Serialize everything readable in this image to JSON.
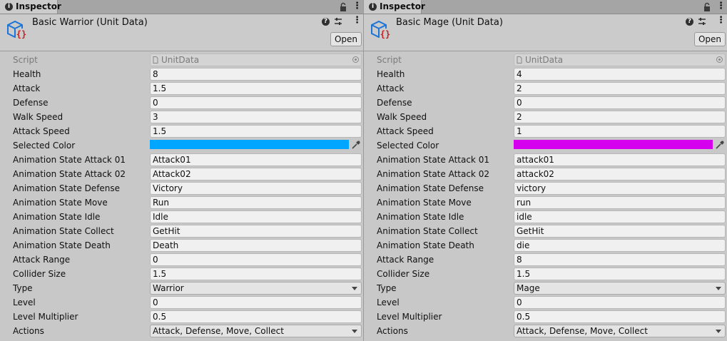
{
  "panels": [
    {
      "tab": {
        "label": "Inspector",
        "info_glyph": "i",
        "menu_glyph": "⋮"
      },
      "header": {
        "title": "Basic Warrior (Unit Data)",
        "help_glyph": "?",
        "menu_glyph": "⋮",
        "open_label": "Open"
      },
      "fields": {
        "script": {
          "label": "Script",
          "value": "UnitData"
        },
        "health": {
          "label": "Health",
          "value": "8"
        },
        "attack": {
          "label": "Attack",
          "value": "1.5"
        },
        "defense": {
          "label": "Defense",
          "value": "0"
        },
        "walk_speed": {
          "label": "Walk Speed",
          "value": "3"
        },
        "attack_speed": {
          "label": "Attack Speed",
          "value": "1.5"
        },
        "selected_color": {
          "label": "Selected Color",
          "value": "#00a6ff"
        },
        "anim_attack01": {
          "label": "Animation State Attack 01",
          "value": "Attack01"
        },
        "anim_attack02": {
          "label": "Animation State Attack 02",
          "value": "Attack02"
        },
        "anim_defense": {
          "label": "Animation State Defense",
          "value": "Victory"
        },
        "anim_move": {
          "label": "Animation State Move",
          "value": "Run"
        },
        "anim_idle": {
          "label": "Animation State Idle",
          "value": "Idle"
        },
        "anim_collect": {
          "label": "Animation State Collect",
          "value": "GetHit"
        },
        "anim_death": {
          "label": "Animation State Death",
          "value": "Death"
        },
        "attack_range": {
          "label": "Attack Range",
          "value": "0"
        },
        "collider_size": {
          "label": "Collider Size",
          "value": "1.5"
        },
        "type": {
          "label": "Type",
          "value": "Warrior"
        },
        "level": {
          "label": "Level",
          "value": "0"
        },
        "level_multiplier": {
          "label": "Level Multiplier",
          "value": "0.5"
        },
        "actions": {
          "label": "Actions",
          "value": "Attack, Defense, Move, Collect"
        }
      }
    },
    {
      "tab": {
        "label": "Inspector",
        "info_glyph": "i",
        "menu_glyph": "⋮"
      },
      "header": {
        "title": "Basic Mage (Unit Data)",
        "help_glyph": "?",
        "menu_glyph": "⋮",
        "open_label": "Open"
      },
      "fields": {
        "script": {
          "label": "Script",
          "value": "UnitData"
        },
        "health": {
          "label": "Health",
          "value": "4"
        },
        "attack": {
          "label": "Attack",
          "value": "2"
        },
        "defense": {
          "label": "Defense",
          "value": "0"
        },
        "walk_speed": {
          "label": "Walk Speed",
          "value": "2"
        },
        "attack_speed": {
          "label": "Attack Speed",
          "value": "1"
        },
        "selected_color": {
          "label": "Selected Color",
          "value": "#d400ee"
        },
        "anim_attack01": {
          "label": "Animation State Attack 01",
          "value": "attack01"
        },
        "anim_attack02": {
          "label": "Animation State Attack 02",
          "value": "attack02"
        },
        "anim_defense": {
          "label": "Animation State Defense",
          "value": "victory"
        },
        "anim_move": {
          "label": "Animation State Move",
          "value": "run"
        },
        "anim_idle": {
          "label": "Animation State Idle",
          "value": "idle"
        },
        "anim_collect": {
          "label": "Animation State Collect",
          "value": "GetHit"
        },
        "anim_death": {
          "label": "Animation State Death",
          "value": "die"
        },
        "attack_range": {
          "label": "Attack Range",
          "value": "8"
        },
        "collider_size": {
          "label": "Collider Size",
          "value": "1.5"
        },
        "type": {
          "label": "Type",
          "value": "Mage"
        },
        "level": {
          "label": "Level",
          "value": "0"
        },
        "level_multiplier": {
          "label": "Level Multiplier",
          "value": "0.5"
        },
        "actions": {
          "label": "Actions",
          "value": "Attack, Defense, Move, Collect"
        }
      }
    }
  ],
  "colors": {
    "accent_icon": "#1b74d6",
    "script_brace": "#c52020"
  }
}
